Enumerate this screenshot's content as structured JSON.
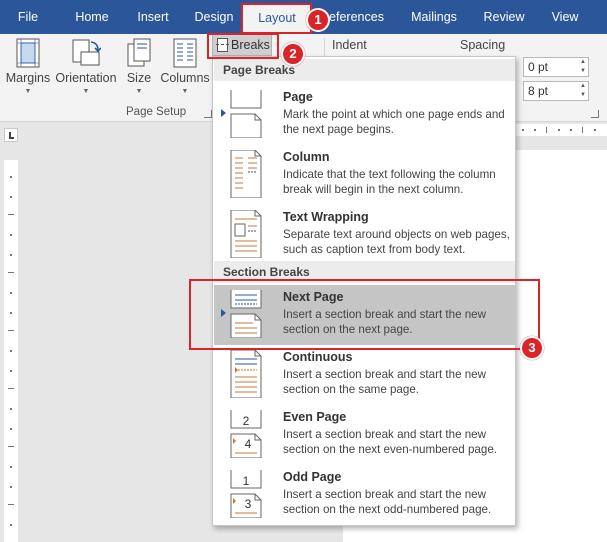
{
  "tabs": [
    {
      "label": "File"
    },
    {
      "label": "Home"
    },
    {
      "label": "Insert"
    },
    {
      "label": "Design"
    },
    {
      "label": "Layout"
    },
    {
      "label": "References"
    },
    {
      "label": "Mailings"
    },
    {
      "label": "Review"
    },
    {
      "label": "View"
    }
  ],
  "ribbon": {
    "page_setup": {
      "buttons": [
        {
          "label": "Margins",
          "icon": "margins-icon"
        },
        {
          "label": "Orientation",
          "icon": "orientation-icon"
        },
        {
          "label": "Size",
          "icon": "size-icon"
        },
        {
          "label": "Columns",
          "icon": "columns-icon"
        }
      ],
      "breaks_label": "Breaks",
      "group_label": "Page Setup"
    },
    "indent_label": "Indent",
    "spacing_label": "Spacing",
    "spacing_before": "0 pt",
    "spacing_after": "8 pt"
  },
  "menu": {
    "page_breaks_header": "Page Breaks",
    "section_breaks_header": "Section Breaks",
    "page_items": [
      {
        "title": "Page",
        "desc": "Mark the point at which one page ends and the next page begins."
      },
      {
        "title": "Column",
        "desc": "Indicate that the text following the column break will begin in the next column."
      },
      {
        "title": "Text Wrapping",
        "desc": "Separate text around objects on web pages, such as caption text from body text."
      }
    ],
    "section_items": [
      {
        "title": "Next Page",
        "desc": "Insert a section break and start the new section on the next page."
      },
      {
        "title": "Continuous",
        "desc": "Insert a section break and start the new section on the same page."
      },
      {
        "title": "Even Page",
        "desc": "Insert a section break and start the new section on the next even-numbered page."
      },
      {
        "title": "Odd Page",
        "desc": "Insert a section break and start the new section on the next odd-numbered page."
      }
    ],
    "even_icon_number": "2",
    "even_icon_number_next": "4",
    "odd_icon_number": "1",
    "odd_icon_number_next": "3"
  },
  "annotations": [
    "1",
    "2",
    "3"
  ],
  "colors": {
    "accent": "#2b579a",
    "highlight": "#d9252a"
  }
}
